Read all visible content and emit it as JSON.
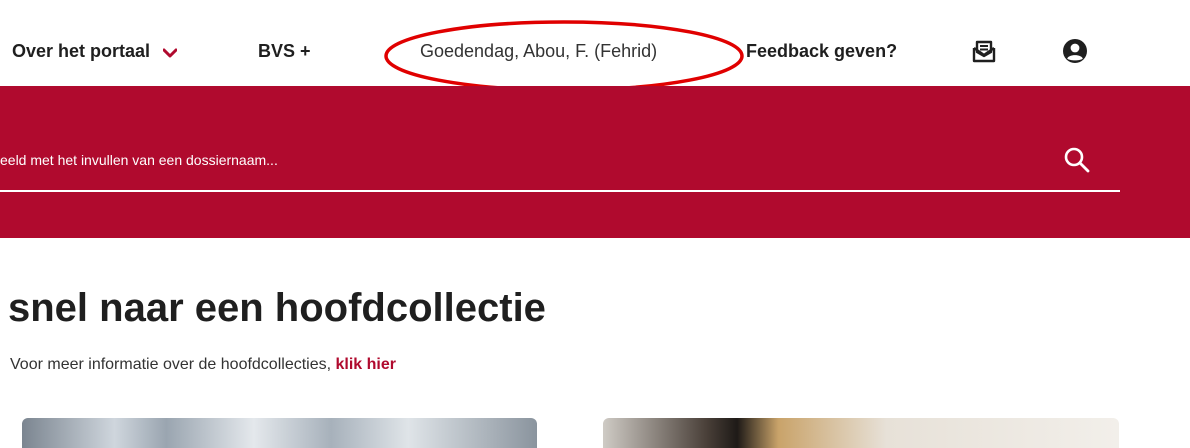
{
  "nav": {
    "portal_label": "Over het portaal",
    "bvs_label": "BVS +",
    "greeting": "Goedendag, Abou, F. (Fehrid)",
    "feedback_label": "Feedback geven?",
    "feedback_icon": "feedback-icon",
    "user_icon": "user-icon",
    "accent_color": "#b00a2e",
    "annotation_color": "#e00000"
  },
  "search": {
    "placeholder": "eeld met het invullen van een dossiernaam..."
  },
  "main": {
    "title": "snel naar een hoofdcollectie",
    "intro_text": "Voor meer informatie over de hoofdcollecties, ",
    "intro_link": "klik hier"
  }
}
